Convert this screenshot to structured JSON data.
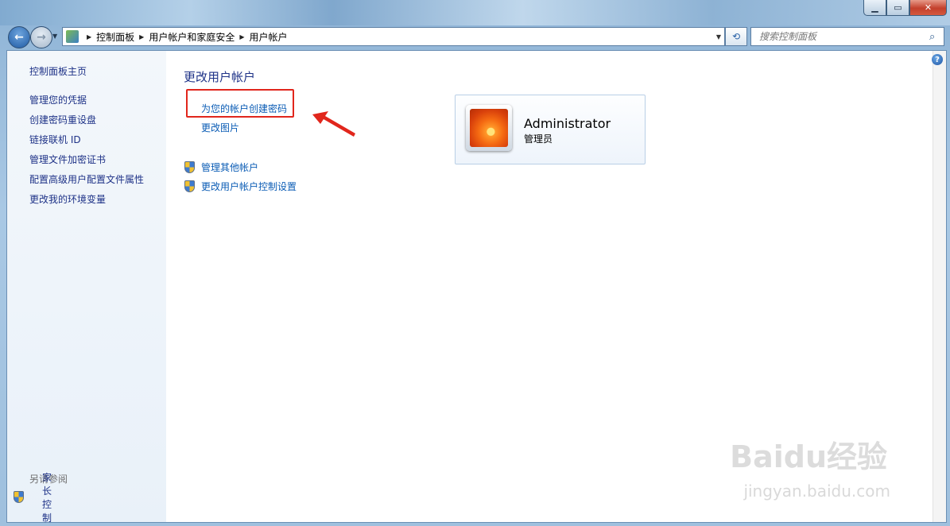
{
  "breadcrumb": [
    "控制面板",
    "用户帐户和家庭安全",
    "用户帐户"
  ],
  "search": {
    "placeholder": "搜索控制面板"
  },
  "sidebar": {
    "home": "控制面板主页",
    "items": [
      "管理您的凭据",
      "创建密码重设盘",
      "链接联机 ID",
      "管理文件加密证书",
      "配置高级用户配置文件属性",
      "更改我的环境变量"
    ],
    "see_also": "另请参阅",
    "parental": "家长控制"
  },
  "main": {
    "heading": "更改用户帐户",
    "links": [
      "为您的帐户创建密码",
      "更改图片"
    ],
    "shield_links": [
      "管理其他帐户",
      "更改用户帐户控制设置"
    ]
  },
  "account": {
    "name": "Administrator",
    "role": "管理员"
  },
  "watermark": {
    "logo": "Baidu经验",
    "url": "jingyan.baidu.com"
  },
  "colors": {
    "link": "#0b5cb5",
    "sidebar_link": "#1e3287",
    "highlight": "#e1261c"
  },
  "icons": [
    "back-icon",
    "forward-icon",
    "control-panel-icon",
    "refresh-icon",
    "search-icon",
    "uac-shield-icon",
    "help-icon"
  ]
}
